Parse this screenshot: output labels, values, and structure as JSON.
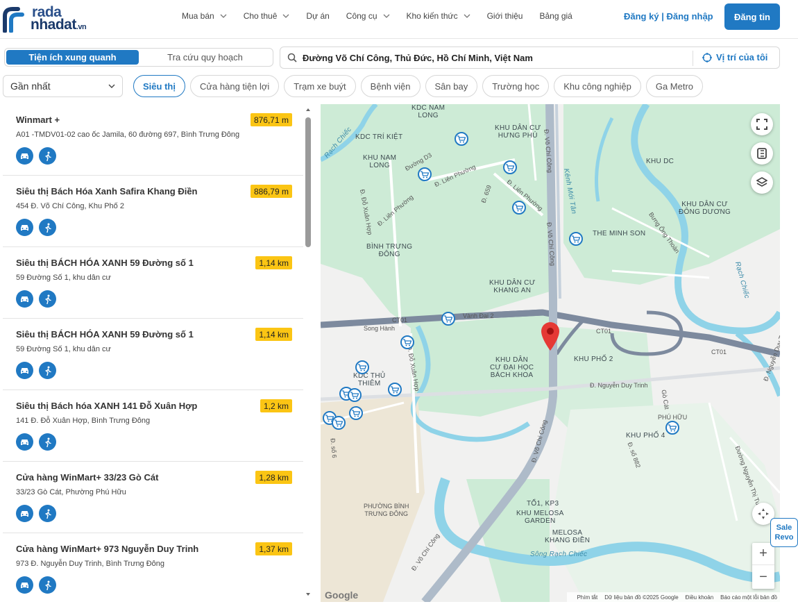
{
  "brand": {
    "line1": "rada",
    "line2": "nhadat",
    "suffix": ".vn"
  },
  "nav": [
    {
      "label": "Mua bán",
      "dropdown": true
    },
    {
      "label": "Cho thuê",
      "dropdown": true
    },
    {
      "label": "Dự án",
      "dropdown": false
    },
    {
      "label": "Công cụ",
      "dropdown": true
    },
    {
      "label": "Kho kiến thức",
      "dropdown": true
    },
    {
      "label": "Giới thiệu",
      "dropdown": false
    },
    {
      "label": "Bảng giá",
      "dropdown": false
    }
  ],
  "auth": {
    "register": "Đăng ký",
    "separator": " | ",
    "login": "Đăng nhập"
  },
  "post_button": "Đăng tin",
  "mode_tabs": {
    "active": "Tiện ích xung quanh",
    "inactive": "Tra cứu quy hoạch"
  },
  "search": {
    "value": "Đường Võ Chí Công, Thủ Đức, Hồ Chí Minh, Việt Nam",
    "my_location": "Vị trí của tôi"
  },
  "sort": {
    "selected": "Gần nhất"
  },
  "categories": [
    "Siêu thị",
    "Cửa hàng tiện lợi",
    "Trạm xe buýt",
    "Bệnh viện",
    "Sân bay",
    "Trường học",
    "Khu công nghiệp",
    "Ga Metro"
  ],
  "active_category": "Siêu thị",
  "places": [
    {
      "name": "Winmart +",
      "address": "A01 -TMDV01-02 cao ốc Jamila, 60 đường 697, Bình Trưng Đông",
      "distance": "876,71 m"
    },
    {
      "name": "Siêu thị Bách Hóa Xanh Safira Khang Điền",
      "address": "454 Đ. Võ Chí Công, Khu Phố 2",
      "distance": "886,79 m"
    },
    {
      "name": "Siêu thị BÁCH HÓA XANH 59 Đường số 1",
      "address": "59 Đường Số 1, khu dân cư",
      "distance": "1,14 km"
    },
    {
      "name": "Siêu thị BÁCH HÓA XANH 59 Đường số 1",
      "address": "59 Đường Số 1, khu dân cư",
      "distance": "1,14 km"
    },
    {
      "name": "Siêu thị Bách hóa XANH 141 Đỗ Xuân Hợp",
      "address": "141 Đ. Đỗ Xuân Hợp, Bình Trưng Đông",
      "distance": "1,2 km"
    },
    {
      "name": "Cửa hàng WinMart+ 33/23 Gò Cát",
      "address": "33/23 Gò Cát, Phường Phú Hữu",
      "distance": "1,28 km"
    },
    {
      "name": "Cửa hàng WinMart+ 973 Nguyễn Duy Trinh",
      "address": "973 Đ. Nguyễn Duy Trinh, Bình Trưng Đông",
      "distance": "1,37 km"
    }
  ],
  "map": {
    "labels": {
      "kdc_nam_long_top": "KDC NAM\nLONG",
      "kdc_tri_kiet": "KDC TRÍ KIỆT",
      "khu_dan_cu_hung_phu": "KHU DÂN CƯ\nHƯNG PHÚ",
      "khu_nam_long": "KHU NAM\nLONG",
      "khu_dc": "KHU DC",
      "khu_dan_cu_dong_duong": "KHU DÂN CƯ\nĐÔNG DƯƠNG",
      "the_minh_son": "THE MINH SON",
      "binh_trung_dong": "BÌNH TRƯNG\nĐÔNG",
      "khu_dan_cu_khang_an": "KHU DÂN CƯ\nKHANG AN",
      "khu_dan_cu_dai_hoc": "KHU DÂN\nCƯ ĐẠI HỌC\nBÁCH KHOA",
      "khu_pho_2": "KHU PHỐ 2",
      "kdc_thu_thiem": "KDC THỦ\nTHIÊM",
      "phu_huu": "PHÚ HỮU",
      "khu_pho_4": "KHU PHỐ 4",
      "phuong_binh_trung_dong": "PHƯỜNG BÌNH\nTRƯNG ĐÔNG",
      "kp3": "TỔ1, KP3",
      "khu_melosa": "KHU MELOSA\nGARDEN",
      "melosa_khang_dien": "MELOSA\nKHANG ĐIỀN",
      "song_hanh": "Song Hành",
      "vanh_dai_2": "Vành Đai 2",
      "ct01_left": "CT01",
      "ct01_right": "CT01",
      "ct01_far": "CT01",
      "nguyen_duy_trinh": "Đ. Nguyễn Duy Trinh",
      "song_rach_chiec": "Sông Rạch Chiếc",
      "rach_chiec_right": "Rạch Chiếc",
      "rach_chiec_left": "Rạch Chiếc",
      "vo_chi_cong_1": "Đ. Võ Chí Công",
      "vo_chi_cong_2": "Đ. Võ Chí Công",
      "vo_chi_cong_3": "Đ. Võ Chí Công",
      "vo_chi_cong_4": "Đ. Võ Chí Công",
      "lien_phuong_1": "Đ. Liên Phường",
      "lien_phuong_2": "Đ. Liên Phường",
      "lien_phuong_3": "Đ. Liên Phường",
      "do_xuan_hop_1": "Đ. Đỗ Xuân Hợp",
      "do_xuan_hop_2": "Đ. Đỗ Xuân Hợp",
      "duong_d3": "Đường D3",
      "duong_659": "Đ. 659",
      "nguyen_duy_trinh_2": "Đ. Nguyễn Duy Trinh",
      "vanh_dai_trong": "Kênh Mới Tân",
      "bung_ong_thoan": "Bưng Ông Thoàn",
      "go_cat": "Gò Cát",
      "duong_882": "Đ. số 882",
      "duong_nguyen_thi_tu": "Đường Nguyễn Thị Tư",
      "duong_so_6": "Đ. số 6"
    },
    "google": "Google",
    "attribution": [
      "Phím tắt",
      "Dữ liệu bản đồ ©2025 Google",
      "Điều khoản",
      "Báo cáo một lỗi bản đồ"
    ]
  },
  "sale_widget": {
    "line1": "Sale",
    "line2": "Revo"
  },
  "colors": {
    "primary": "#2079c3",
    "distance_badge": "#fbc514",
    "map_green": "#c8ead3",
    "map_water": "#8fd3e8",
    "marker": "#e53935"
  }
}
